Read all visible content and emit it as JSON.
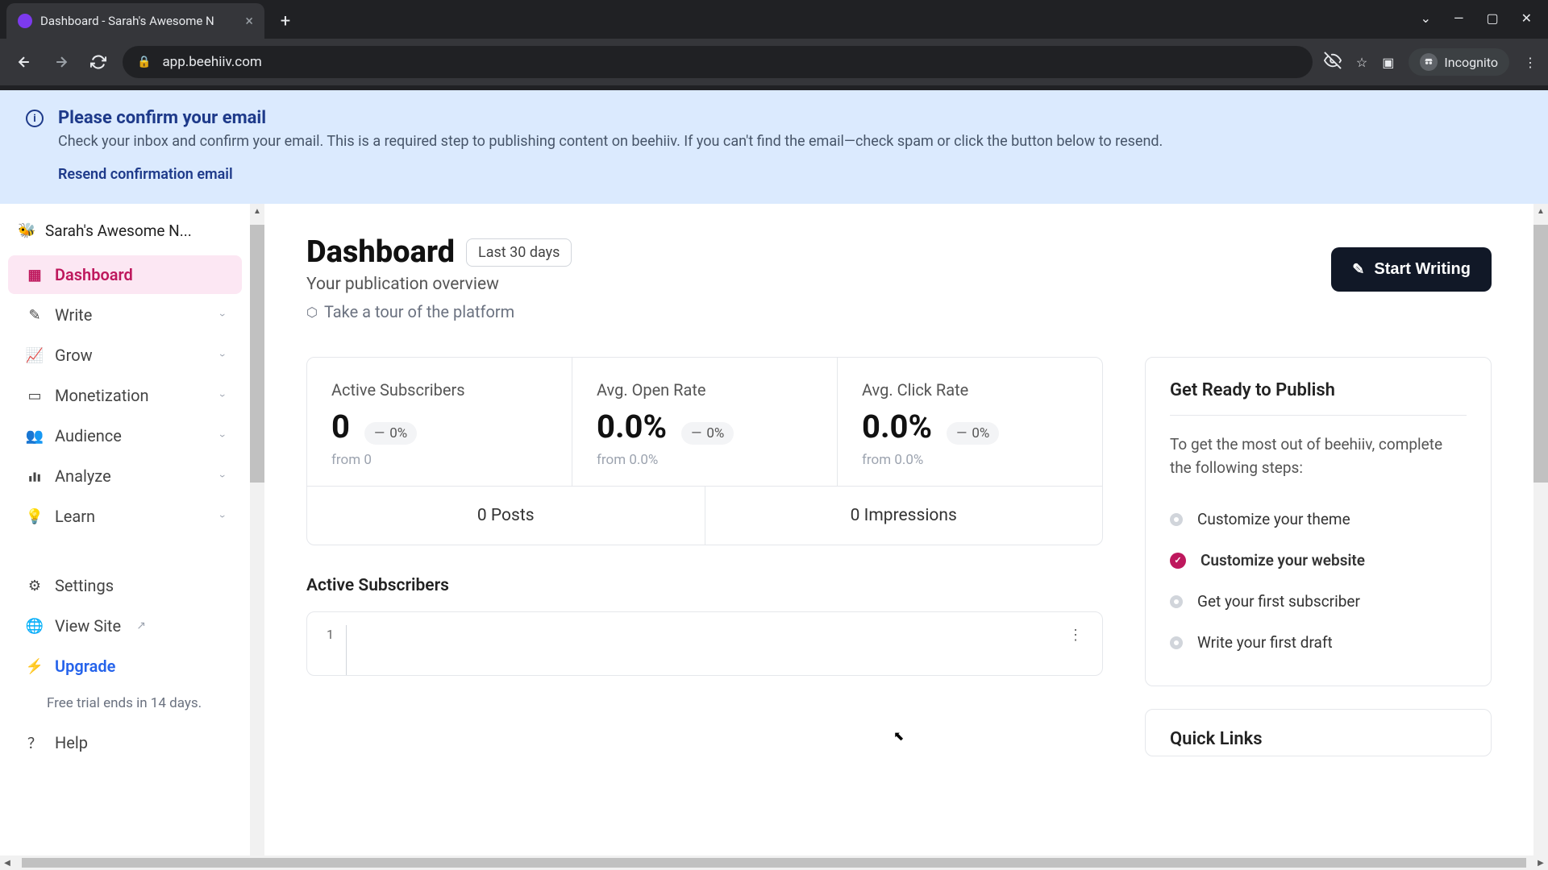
{
  "browser": {
    "tab_title": "Dashboard - Sarah's Awesome N",
    "url": "app.beehiiv.com",
    "incognito_label": "Incognito"
  },
  "banner": {
    "title": "Please confirm your email",
    "text": "Check your inbox and confirm your email. This is a required step to publishing content on beehiiv. If you can't find the email—check spam or click the button below to resend.",
    "action": "Resend confirmation email"
  },
  "sidebar": {
    "publication_name": "Sarah's Awesome N...",
    "items": [
      {
        "label": "Dashboard"
      },
      {
        "label": "Write"
      },
      {
        "label": "Grow"
      },
      {
        "label": "Monetization"
      },
      {
        "label": "Audience"
      },
      {
        "label": "Analyze"
      },
      {
        "label": "Learn"
      }
    ],
    "settings": "Settings",
    "view_site": "View Site",
    "upgrade": "Upgrade",
    "trial_text": "Free trial ends in 14 days.",
    "help": "Help"
  },
  "header": {
    "title": "Dashboard",
    "date_range": "Last 30 days",
    "subtitle": "Your publication overview",
    "tour_link": "Take a tour of the platform",
    "start_writing": "Start Writing"
  },
  "stats": [
    {
      "label": "Active Subscribers",
      "value": "0",
      "delta": "0%",
      "from": "from 0"
    },
    {
      "label": "Avg. Open Rate",
      "value": "0.0%",
      "delta": "0%",
      "from": "from 0.0%"
    },
    {
      "label": "Avg. Click Rate",
      "value": "0.0%",
      "delta": "0%",
      "from": "from 0.0%"
    }
  ],
  "posts_row": {
    "posts": "0 Posts",
    "impressions": "0 Impressions"
  },
  "chart_section_title": "Active Subscribers",
  "chart_data": {
    "type": "line",
    "title": "Active Subscribers",
    "y_tick": "1",
    "ylim": [
      0,
      1
    ],
    "series": [
      {
        "name": "Active Subscribers",
        "values": []
      }
    ]
  },
  "ready": {
    "title": "Get Ready to Publish",
    "text": "To get the most out of beehiiv, complete the following steps:",
    "items": [
      {
        "label": "Customize your theme",
        "done": false
      },
      {
        "label": "Customize your website",
        "done": true
      },
      {
        "label": "Get your first subscriber",
        "done": false
      },
      {
        "label": "Write your first draft",
        "done": false
      }
    ]
  },
  "quick_links": {
    "title": "Quick Links"
  }
}
